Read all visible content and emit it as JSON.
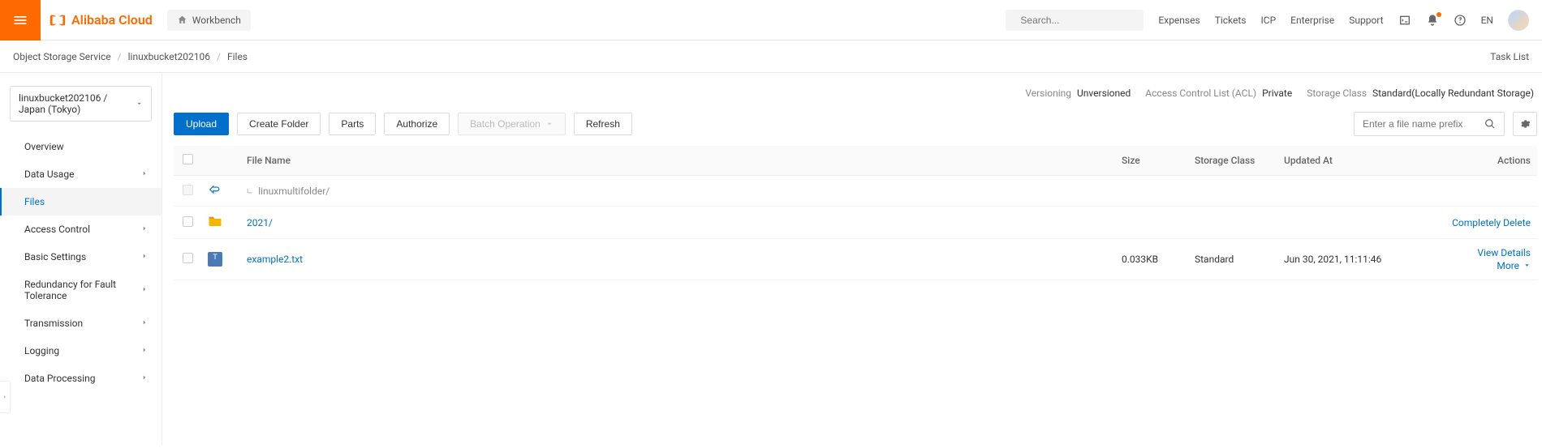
{
  "header": {
    "brand": "Alibaba Cloud",
    "workbench": "Workbench",
    "search_placeholder": "Search...",
    "nav": {
      "expenses": "Expenses",
      "tickets": "Tickets",
      "icp": "ICP",
      "enterprise": "Enterprise",
      "support": "Support",
      "lang": "EN"
    }
  },
  "breadcrumb": {
    "a": "Object Storage Service",
    "b": "linuxbucket202106",
    "c": "Files",
    "tasklist": "Task List"
  },
  "sidebar": {
    "bucket": "linuxbucket202106 / Japan (Tokyo)",
    "items": [
      {
        "label": "Overview",
        "expandable": false
      },
      {
        "label": "Data Usage",
        "expandable": true
      },
      {
        "label": "Files",
        "expandable": false,
        "active": true
      },
      {
        "label": "Access Control",
        "expandable": true
      },
      {
        "label": "Basic Settings",
        "expandable": true
      },
      {
        "label": "Redundancy for Fault Tolerance",
        "expandable": true
      },
      {
        "label": "Transmission",
        "expandable": true
      },
      {
        "label": "Logging",
        "expandable": true
      },
      {
        "label": "Data Processing",
        "expandable": true
      }
    ]
  },
  "infostrip": {
    "versioning_label": "Versioning",
    "versioning_value": "Unversioned",
    "acl_label": "Access Control List (ACL)",
    "acl_value": "Private",
    "storage_label": "Storage Class",
    "storage_value": "Standard(Locally Redundant Storage)"
  },
  "toolbar": {
    "upload": "Upload",
    "create_folder": "Create Folder",
    "parts": "Parts",
    "authorize": "Authorize",
    "batch": "Batch Operation",
    "refresh": "Refresh",
    "prefix_placeholder": "Enter a file name prefix"
  },
  "table": {
    "headers": {
      "filename": "File Name",
      "size": "Size",
      "storage": "Storage Class",
      "updated": "Updated At",
      "actions": "Actions"
    },
    "path_row": {
      "current": "linuxmultifolder/"
    },
    "folder_row": {
      "name": "2021/",
      "action": "Completely Delete"
    },
    "file_row": {
      "name": "example2.txt",
      "size": "0.033KB",
      "storage": "Standard",
      "updated": "Jun 30, 2021, 11:11:46",
      "view": "View Details",
      "more": "More"
    }
  }
}
